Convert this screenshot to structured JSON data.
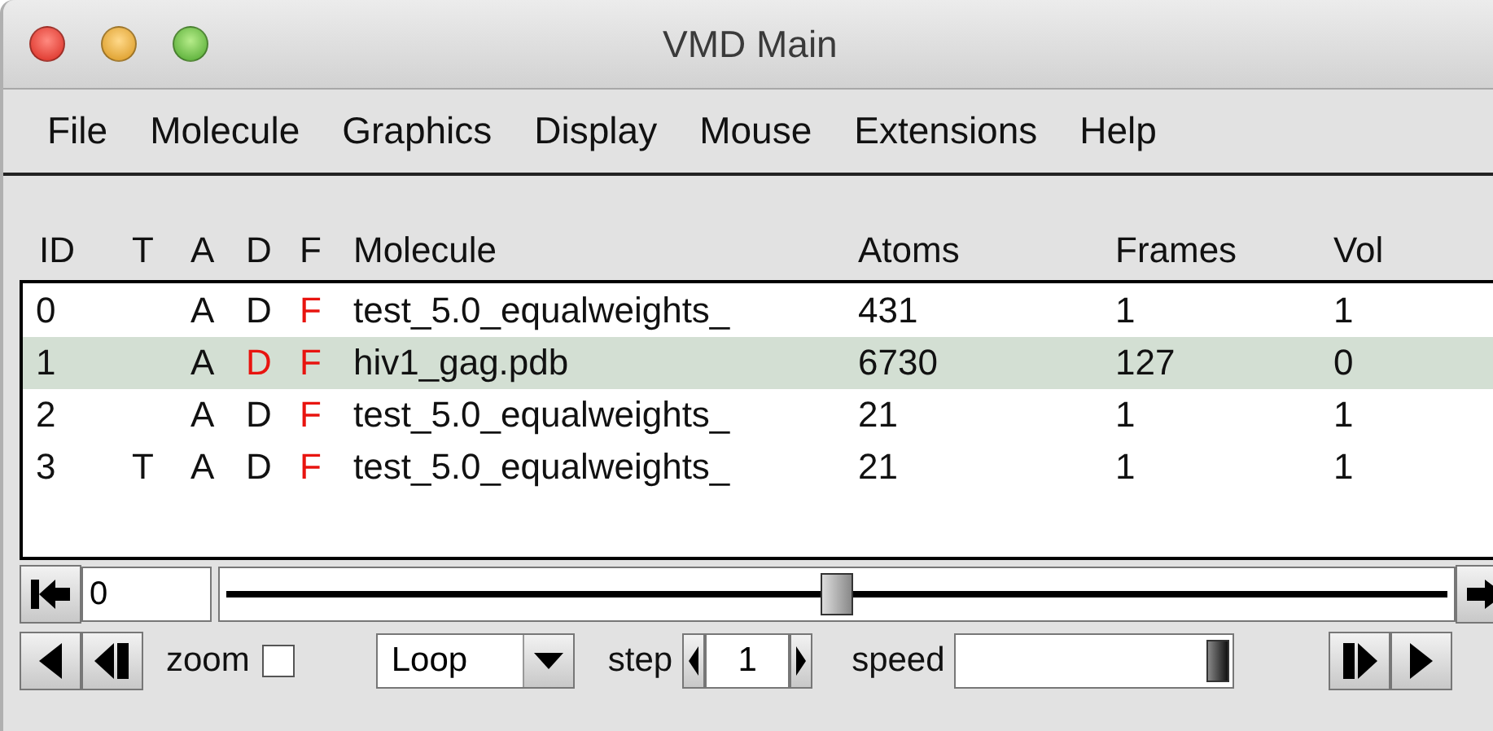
{
  "window": {
    "title": "VMD Main"
  },
  "menu": [
    "File",
    "Molecule",
    "Graphics",
    "Display",
    "Mouse",
    "Extensions",
    "Help"
  ],
  "table": {
    "columns": [
      "ID",
      "T",
      "A",
      "D",
      "F",
      "Molecule",
      "Atoms",
      "Frames",
      "Vol"
    ],
    "rows": [
      {
        "id": "0",
        "t": "",
        "a": "A",
        "active": true,
        "d": "D",
        "displayed": true,
        "f": "F",
        "fixed": false,
        "molecule": "test_5.0_equalweights_",
        "atoms": "431",
        "frames": "1",
        "vol": "1",
        "selected": false
      },
      {
        "id": "1",
        "t": "",
        "a": "A",
        "active": true,
        "d": "D",
        "displayed": false,
        "f": "F",
        "fixed": false,
        "molecule": "hiv1_gag.pdb",
        "atoms": "6730",
        "frames": "127",
        "vol": "0",
        "selected": true
      },
      {
        "id": "2",
        "t": "",
        "a": "A",
        "active": true,
        "d": "D",
        "displayed": true,
        "f": "F",
        "fixed": false,
        "molecule": "test_5.0_equalweights_",
        "atoms": "21",
        "frames": "1",
        "vol": "1",
        "selected": false
      },
      {
        "id": "3",
        "t": "T",
        "a": "A",
        "active": true,
        "d": "D",
        "displayed": true,
        "f": "F",
        "fixed": false,
        "molecule": "test_5.0_equalweights_",
        "atoms": "21",
        "frames": "1",
        "vol": "1",
        "selected": false
      }
    ]
  },
  "animation": {
    "frame_value": "0",
    "frame_slider": {
      "level": 0.5
    },
    "zoom": {
      "label": "zoom",
      "checked": false
    },
    "loop": {
      "value": "Loop"
    },
    "step": {
      "label": "step",
      "value": "1"
    },
    "speed": {
      "label": "speed",
      "level": 1
    }
  }
}
